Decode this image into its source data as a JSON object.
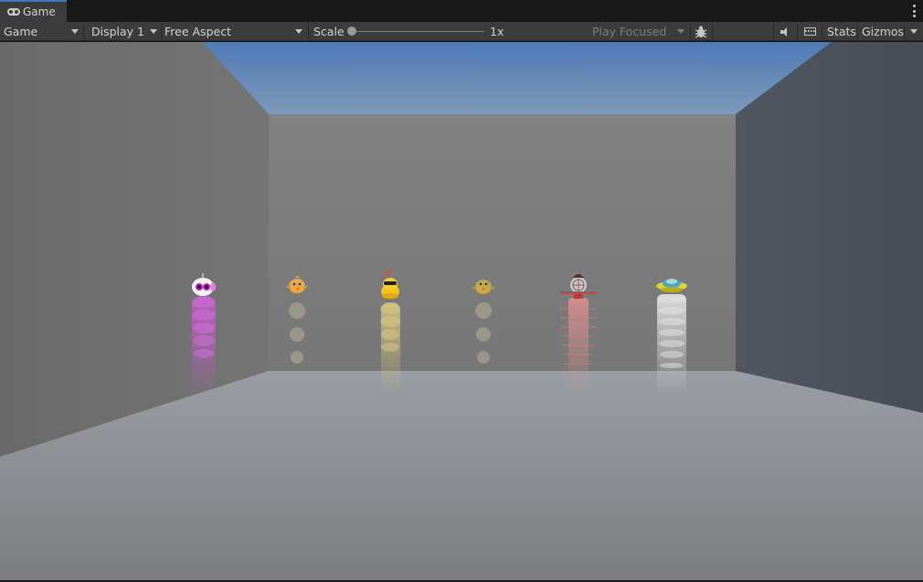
{
  "tab": {
    "title": "Game",
    "icon": "gamepad-icon"
  },
  "toolbar": {
    "view_mode": "Game",
    "display": "Display 1",
    "aspect": "Free Aspect",
    "scale_label": "Scale",
    "scale_value": "1x",
    "play_mode": "Play Focused",
    "stats_label": "Stats",
    "gizmos_label": "Gizmos",
    "scale_slider_fraction": 0.0
  },
  "icons": {
    "more": "kebab-menu-icon",
    "bug": "bug-icon",
    "audio": "speaker-icon",
    "keyboard": "keyboard-icon"
  },
  "scene": {
    "sky_color": "#6d8fba",
    "floor_color": "#8b8e92",
    "characters": [
      {
        "name": "purple-robot",
        "trail_color": "#c45fc4"
      },
      {
        "name": "orange-chick",
        "trail_color": "#b8aa94"
      },
      {
        "name": "yellow-bird",
        "trail_color": "#cfc07a"
      },
      {
        "name": "green-chick",
        "trail_color": "#b8aa94"
      },
      {
        "name": "red-plane",
        "trail_color": "#d28d8d"
      },
      {
        "name": "ufo",
        "trail_color": "#d9d9d9"
      }
    ]
  }
}
